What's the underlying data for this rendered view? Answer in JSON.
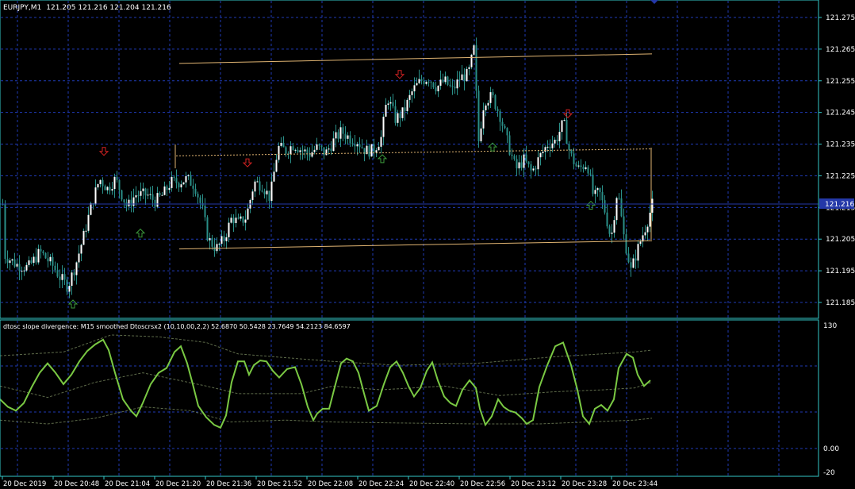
{
  "main_chart": {
    "symbol": "EURJPY,M1",
    "ohlc": "121.205 121.216 121.204 121.216",
    "price_ticks": [
      "121.275",
      "121.265",
      "121.255",
      "121.245",
      "121.235",
      "121.225",
      "121.215",
      "121.205",
      "121.195",
      "121.185"
    ],
    "current_price": "121.216",
    "channel_top": [
      121.2605,
      121.2635
    ],
    "channel_mid": [
      121.2313,
      121.2335
    ],
    "channel_bottom": [
      121.2019,
      121.2045
    ],
    "up_arrows": [
      [
        92,
        121.1845
      ],
      [
        177,
        121.2069
      ],
      [
        482,
        121.2304
      ],
      [
        621,
        121.2341
      ],
      [
        745,
        121.2157
      ]
    ],
    "down_arrows": [
      [
        131,
        121.2327
      ],
      [
        312,
        121.2291
      ],
      [
        504,
        121.257
      ],
      [
        716,
        121.2446
      ]
    ],
    "close_path": [
      [
        5,
        121.2
      ],
      [
        20,
        121.197
      ],
      [
        35,
        121.196
      ],
      [
        50,
        121.201
      ],
      [
        65,
        121.197
      ],
      [
        75,
        121.193
      ],
      [
        85,
        121.19
      ],
      [
        95,
        121.197
      ],
      [
        105,
        121.206
      ],
      [
        115,
        121.216
      ],
      [
        125,
        121.224
      ],
      [
        135,
        121.221
      ],
      [
        145,
        121.224
      ],
      [
        160,
        121.215
      ],
      [
        170,
        121.219
      ],
      [
        185,
        121.219
      ],
      [
        195,
        121.217
      ],
      [
        205,
        121.219
      ],
      [
        215,
        121.223
      ],
      [
        225,
        121.223
      ],
      [
        235,
        121.224
      ],
      [
        245,
        121.222
      ],
      [
        255,
        121.214
      ],
      [
        262,
        121.205
      ],
      [
        272,
        121.202
      ],
      [
        282,
        121.205
      ],
      [
        292,
        121.212
      ],
      [
        300,
        121.21
      ],
      [
        310,
        121.212
      ],
      [
        320,
        121.223
      ],
      [
        330,
        121.222
      ],
      [
        340,
        121.218
      ],
      [
        350,
        121.234
      ],
      [
        360,
        121.233
      ],
      [
        370,
        121.235
      ],
      [
        380,
        121.233
      ],
      [
        390,
        121.232
      ],
      [
        400,
        121.234
      ],
      [
        410,
        121.232
      ],
      [
        420,
        121.236
      ],
      [
        430,
        121.239
      ],
      [
        440,
        121.237
      ],
      [
        450,
        121.236
      ],
      [
        460,
        121.233
      ],
      [
        470,
        121.233
      ],
      [
        480,
        121.237
      ],
      [
        488,
        121.25
      ],
      [
        498,
        121.243
      ],
      [
        508,
        121.245
      ],
      [
        520,
        121.252
      ],
      [
        530,
        121.255
      ],
      [
        540,
        121.256
      ],
      [
        550,
        121.253
      ],
      [
        560,
        121.255
      ],
      [
        570,
        121.252
      ],
      [
        580,
        121.256
      ],
      [
        590,
        121.257
      ],
      [
        597,
        121.265
      ],
      [
        603,
        121.236
      ],
      [
        610,
        121.249
      ],
      [
        620,
        121.25
      ],
      [
        630,
        121.244
      ],
      [
        640,
        121.235
      ],
      [
        650,
        121.227
      ],
      [
        660,
        121.23
      ],
      [
        670,
        121.226
      ],
      [
        680,
        121.231
      ],
      [
        690,
        121.235
      ],
      [
        700,
        121.236
      ],
      [
        710,
        121.242
      ],
      [
        718,
        121.232
      ],
      [
        728,
        121.227
      ],
      [
        740,
        121.229
      ],
      [
        748,
        121.218
      ],
      [
        755,
        121.22
      ],
      [
        762,
        121.214
      ],
      [
        770,
        121.205
      ],
      [
        778,
        121.221
      ],
      [
        786,
        121.206
      ],
      [
        795,
        121.195
      ],
      [
        805,
        121.203
      ],
      [
        815,
        121.21
      ],
      [
        822,
        121.216
      ]
    ]
  },
  "indicator": {
    "title": "dtosc slope divergence: M15  smoothed Dtoscrsx2  (10,10,00,2,2) 52.6870 50.5428 23.7649 54.2123 84.6597",
    "ticks": [
      "130",
      "0.00",
      "-20"
    ],
    "osc_path": [
      [
        0,
        52
      ],
      [
        10,
        44
      ],
      [
        20,
        40
      ],
      [
        30,
        48
      ],
      [
        40,
        65
      ],
      [
        50,
        80
      ],
      [
        60,
        90
      ],
      [
        70,
        80
      ],
      [
        80,
        68
      ],
      [
        90,
        78
      ],
      [
        100,
        92
      ],
      [
        110,
        103
      ],
      [
        120,
        110
      ],
      [
        130,
        115
      ],
      [
        137,
        104
      ],
      [
        145,
        80
      ],
      [
        155,
        52
      ],
      [
        165,
        40
      ],
      [
        172,
        34
      ],
      [
        180,
        48
      ],
      [
        190,
        68
      ],
      [
        200,
        80
      ],
      [
        210,
        85
      ],
      [
        220,
        102
      ],
      [
        228,
        108
      ],
      [
        236,
        90
      ],
      [
        243,
        68
      ],
      [
        250,
        45
      ],
      [
        260,
        33
      ],
      [
        270,
        25
      ],
      [
        278,
        22
      ],
      [
        285,
        35
      ],
      [
        292,
        70
      ],
      [
        300,
        92
      ],
      [
        308,
        92
      ],
      [
        314,
        78
      ],
      [
        320,
        88
      ],
      [
        328,
        93
      ],
      [
        336,
        92
      ],
      [
        344,
        82
      ],
      [
        352,
        75
      ],
      [
        362,
        84
      ],
      [
        372,
        86
      ],
      [
        380,
        68
      ],
      [
        388,
        44
      ],
      [
        395,
        30
      ],
      [
        400,
        37
      ],
      [
        407,
        42
      ],
      [
        415,
        42
      ],
      [
        423,
        68
      ],
      [
        430,
        90
      ],
      [
        437,
        95
      ],
      [
        445,
        92
      ],
      [
        452,
        80
      ],
      [
        460,
        55
      ],
      [
        465,
        40
      ],
      [
        475,
        45
      ],
      [
        484,
        68
      ],
      [
        492,
        86
      ],
      [
        500,
        92
      ],
      [
        508,
        80
      ],
      [
        515,
        66
      ],
      [
        522,
        55
      ],
      [
        530,
        64
      ],
      [
        538,
        82
      ],
      [
        545,
        91
      ],
      [
        552,
        72
      ],
      [
        560,
        55
      ],
      [
        568,
        48
      ],
      [
        575,
        45
      ],
      [
        583,
        62
      ],
      [
        592,
        72
      ],
      [
        600,
        64
      ],
      [
        605,
        42
      ],
      [
        612,
        25
      ],
      [
        620,
        34
      ],
      [
        628,
        52
      ],
      [
        635,
        44
      ],
      [
        642,
        40
      ],
      [
        650,
        38
      ],
      [
        658,
        32
      ],
      [
        664,
        26
      ],
      [
        672,
        30
      ],
      [
        680,
        65
      ],
      [
        690,
        88
      ],
      [
        700,
        108
      ],
      [
        710,
        112
      ],
      [
        720,
        88
      ],
      [
        728,
        62
      ],
      [
        735,
        34
      ],
      [
        743,
        26
      ],
      [
        750,
        42
      ],
      [
        758,
        46
      ],
      [
        766,
        40
      ],
      [
        774,
        52
      ],
      [
        780,
        85
      ],
      [
        790,
        100
      ],
      [
        798,
        96
      ],
      [
        804,
        78
      ],
      [
        812,
        66
      ],
      [
        820,
        72
      ]
    ],
    "band_upper": [
      [
        0,
        98
      ],
      [
        80,
        102
      ],
      [
        140,
        120
      ],
      [
        200,
        118
      ],
      [
        260,
        112
      ],
      [
        300,
        100
      ],
      [
        420,
        92
      ],
      [
        500,
        88
      ],
      [
        600,
        90
      ],
      [
        700,
        97
      ],
      [
        760,
        100
      ],
      [
        800,
        102
      ],
      [
        822,
        104
      ]
    ],
    "band_mid": [
      [
        0,
        66
      ],
      [
        60,
        54
      ],
      [
        120,
        70
      ],
      [
        180,
        80
      ],
      [
        260,
        66
      ],
      [
        300,
        58
      ],
      [
        380,
        58
      ],
      [
        420,
        66
      ],
      [
        480,
        62
      ],
      [
        560,
        66
      ],
      [
        630,
        56
      ],
      [
        700,
        60
      ],
      [
        760,
        62
      ],
      [
        800,
        64
      ],
      [
        822,
        70
      ]
    ],
    "band_lower": [
      [
        0,
        30
      ],
      [
        60,
        26
      ],
      [
        120,
        32
      ],
      [
        180,
        44
      ],
      [
        240,
        40
      ],
      [
        290,
        28
      ],
      [
        360,
        30
      ],
      [
        420,
        28
      ],
      [
        500,
        27
      ],
      [
        600,
        26
      ],
      [
        680,
        26
      ],
      [
        740,
        28
      ],
      [
        800,
        30
      ],
      [
        822,
        32
      ]
    ]
  },
  "time_labels": [
    "20 Dec 2019",
    "20 Dec 20:48",
    "20 Dec 21:04",
    "20 Dec 21:20",
    "20 Dec 21:36",
    "20 Dec 21:52",
    "20 Dec 22:08",
    "20 Dec 22:24",
    "20 Dec 22:40",
    "20 Dec 22:56",
    "20 Dec 23:12",
    "20 Dec 23:28",
    "20 Dec 23:44"
  ],
  "colors": {
    "bg": "#000000",
    "grid": "#1f3ab4",
    "frame": "#34c7c7",
    "text": "#ffffff",
    "candle": "#2a8f88",
    "channel": "#e0b472",
    "osc": "#7ac943",
    "band": "#5e6b4a",
    "up_arrow": "#3c9a3c",
    "down_arrow": "#d42222",
    "price_box": "#2438a8"
  }
}
